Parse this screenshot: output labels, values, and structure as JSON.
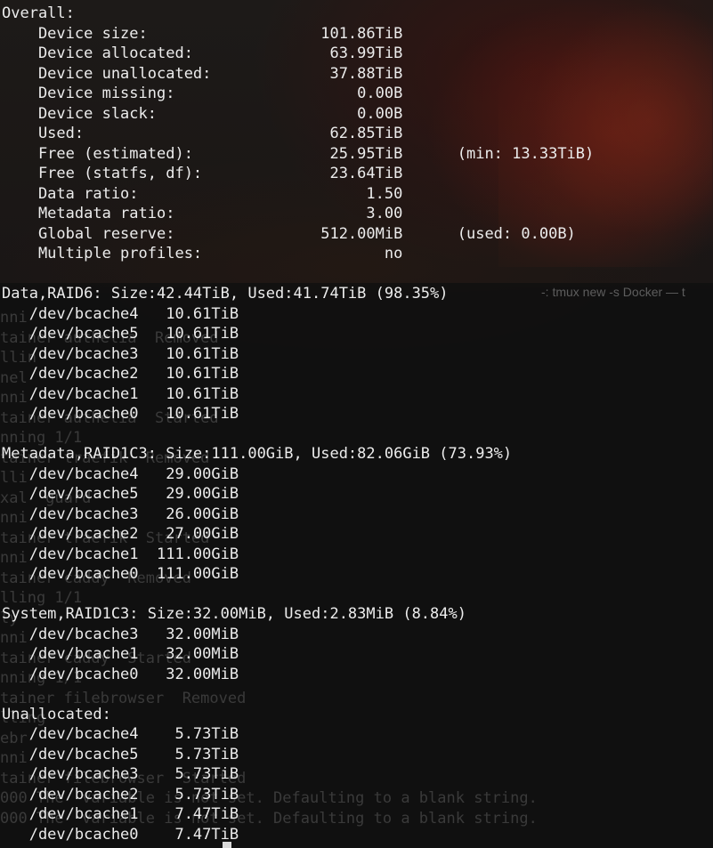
{
  "terminal": {
    "window_hint": "-: tmux new -s Docker — t",
    "overall": {
      "header": "Overall:",
      "rows": [
        {
          "label": "Device size:",
          "value": "101.86TiB",
          "note": ""
        },
        {
          "label": "Device allocated:",
          "value": "63.99TiB",
          "note": ""
        },
        {
          "label": "Device unallocated:",
          "value": "37.88TiB",
          "note": ""
        },
        {
          "label": "Device missing:",
          "value": "0.00B",
          "note": ""
        },
        {
          "label": "Device slack:",
          "value": "0.00B",
          "note": ""
        },
        {
          "label": "Used:",
          "value": "62.85TiB",
          "note": ""
        },
        {
          "label": "Free (estimated):",
          "value": "25.95TiB",
          "note": "(min: 13.33TiB)"
        },
        {
          "label": "Free (statfs, df):",
          "value": "23.64TiB",
          "note": ""
        },
        {
          "label": "Data ratio:",
          "value": "1.50",
          "note": ""
        },
        {
          "label": "Metadata ratio:",
          "value": "3.00",
          "note": ""
        },
        {
          "label": "Global reserve:",
          "value": "512.00MiB",
          "note": "(used: 0.00B)"
        },
        {
          "label": "Multiple profiles:",
          "value": "no",
          "note": ""
        }
      ]
    },
    "sections": [
      {
        "header": "Data,RAID6: Size:42.44TiB, Used:41.74TiB (98.35%)",
        "devices": [
          {
            "device": "/dev/bcache4",
            "size": "10.61TiB"
          },
          {
            "device": "/dev/bcache5",
            "size": "10.61TiB"
          },
          {
            "device": "/dev/bcache3",
            "size": "10.61TiB"
          },
          {
            "device": "/dev/bcache2",
            "size": "10.61TiB"
          },
          {
            "device": "/dev/bcache1",
            "size": "10.61TiB"
          },
          {
            "device": "/dev/bcache0",
            "size": "10.61TiB"
          }
        ]
      },
      {
        "header": "Metadata,RAID1C3: Size:111.00GiB, Used:82.06GiB (73.93%)",
        "devices": [
          {
            "device": "/dev/bcache4",
            "size": "29.00GiB"
          },
          {
            "device": "/dev/bcache5",
            "size": "29.00GiB"
          },
          {
            "device": "/dev/bcache3",
            "size": "26.00GiB"
          },
          {
            "device": "/dev/bcache2",
            "size": "27.00GiB"
          },
          {
            "device": "/dev/bcache1",
            "size": "111.00GiB"
          },
          {
            "device": "/dev/bcache0",
            "size": "111.00GiB"
          }
        ]
      },
      {
        "header": "System,RAID1C3: Size:32.00MiB, Used:2.83MiB (8.84%)",
        "devices": [
          {
            "device": "/dev/bcache3",
            "size": "32.00MiB"
          },
          {
            "device": "/dev/bcache1",
            "size": "32.00MiB"
          },
          {
            "device": "/dev/bcache0",
            "size": "32.00MiB"
          }
        ]
      },
      {
        "header": "Unallocated:",
        "devices": [
          {
            "device": "/dev/bcache4",
            "size": "5.73TiB"
          },
          {
            "device": "/dev/bcache5",
            "size": "5.73TiB"
          },
          {
            "device": "/dev/bcache3",
            "size": "5.73TiB"
          },
          {
            "device": "/dev/bcache2",
            "size": "5.73TiB"
          },
          {
            "device": "/dev/bcache1",
            "size": "7.47TiB"
          },
          {
            "device": "/dev/bcache0",
            "size": "7.47TiB"
          }
        ]
      }
    ],
    "ghost_lines": [
      "nni",
      "tainer authelia  Removed",
      "llin",
      "nel",
      "nni",
      "tainer authelia  Started",
      "nning 1/1",
      "tainer traefik  Removed",
      "lli",
      "xal  guard",
      "nni",
      "tainer traefik  Started",
      "nni",
      "tainer caddy  Removed",
      "lling 1/1",
      "ly",
      "nni",
      "tainer caddy  Started",
      "nning 1/1",
      "tainer filebrowser  Removed",
      "lling",
      "ebr",
      "nni",
      "tainer filebrowser  Started",
      "000 The  variable is not set. Defaulting to a blank string.",
      "000 The  variable is not set. Defaulting to a blank string."
    ]
  }
}
